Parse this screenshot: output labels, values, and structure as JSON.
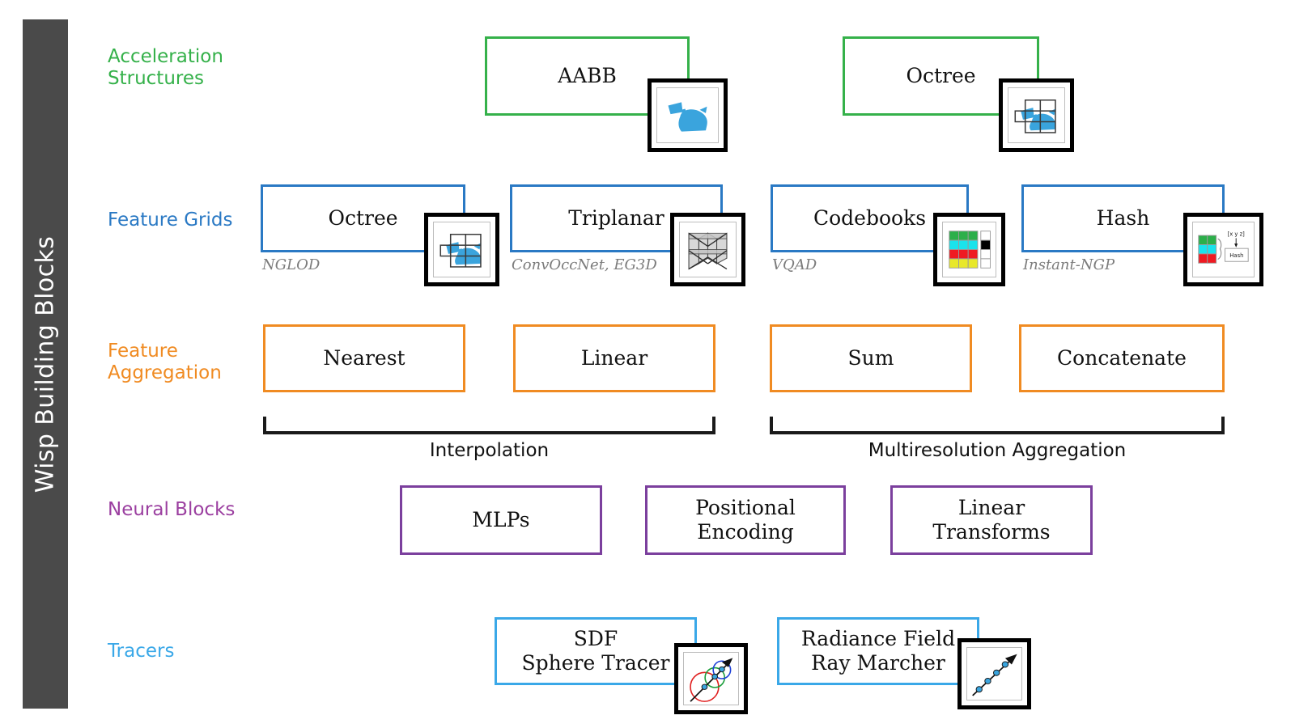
{
  "sidebar": {
    "title": "Wisp Building Blocks",
    "bg_color": "#4a4a4a",
    "text_color": "#ffffff"
  },
  "rows": [
    {
      "id": "acceleration-structures",
      "label": "Acceleration\nStructures",
      "color": "#35b14a"
    },
    {
      "id": "feature-grids",
      "label": "Feature Grids",
      "color": "#2a79c4"
    },
    {
      "id": "feature-aggregation",
      "label": "Feature\nAggregation",
      "color": "#f08b22"
    },
    {
      "id": "neural-blocks",
      "label": "Neural Blocks",
      "color": "#9b3fa0"
    },
    {
      "id": "tracers",
      "label": "Tracers",
      "color": "#3aa8e8"
    }
  ],
  "acceleration_structures": {
    "blocks": [
      {
        "label": "AABB",
        "thumbnail": "aabb-bunny-icon"
      },
      {
        "label": "Octree",
        "thumbnail": "octree-grid-bunny-icon"
      }
    ]
  },
  "feature_grids": {
    "blocks": [
      {
        "label": "Octree",
        "caption": "NGLOD",
        "thumbnail": "octree-grid-bunny-icon"
      },
      {
        "label": "Triplanar",
        "caption": "ConvOccNet, EG3D",
        "thumbnail": "triplanar-planes-icon"
      },
      {
        "label": "Codebooks",
        "caption": "VQAD",
        "thumbnail": "codebook-palette-icon"
      },
      {
        "label": "Hash",
        "caption": "Instant-NGP",
        "thumbnail": "hash-table-icon"
      }
    ]
  },
  "feature_aggregation": {
    "blocks": [
      {
        "label": "Nearest"
      },
      {
        "label": "Linear"
      },
      {
        "label": "Sum"
      },
      {
        "label": "Concatenate"
      }
    ],
    "brackets": [
      {
        "label": "Interpolation"
      },
      {
        "label": "Multiresolution Aggregation"
      }
    ]
  },
  "neural_blocks": {
    "blocks": [
      {
        "label": "MLPs"
      },
      {
        "label": "Positional\nEncoding"
      },
      {
        "label": "Linear\nTransforms"
      }
    ]
  },
  "tracers": {
    "blocks": [
      {
        "label": "SDF\nSphere Tracer",
        "thumbnail": "sphere-trace-icon"
      },
      {
        "label": "Radiance Field\nRay Marcher",
        "thumbnail": "ray-march-icon"
      }
    ]
  },
  "hash_thumbnail": {
    "coord_label": "[x y z]",
    "box_label": "Hash"
  },
  "colors": {
    "green": "#35b14a",
    "blue": "#2a79c4",
    "orange": "#f08b22",
    "purple": "#7b3f9d",
    "light_blue": "#3aa8e8",
    "caption_gray": "#7c7c7c",
    "sidebar_gray": "#4a4a4a",
    "bunny_blue": "#3aa4dd"
  }
}
